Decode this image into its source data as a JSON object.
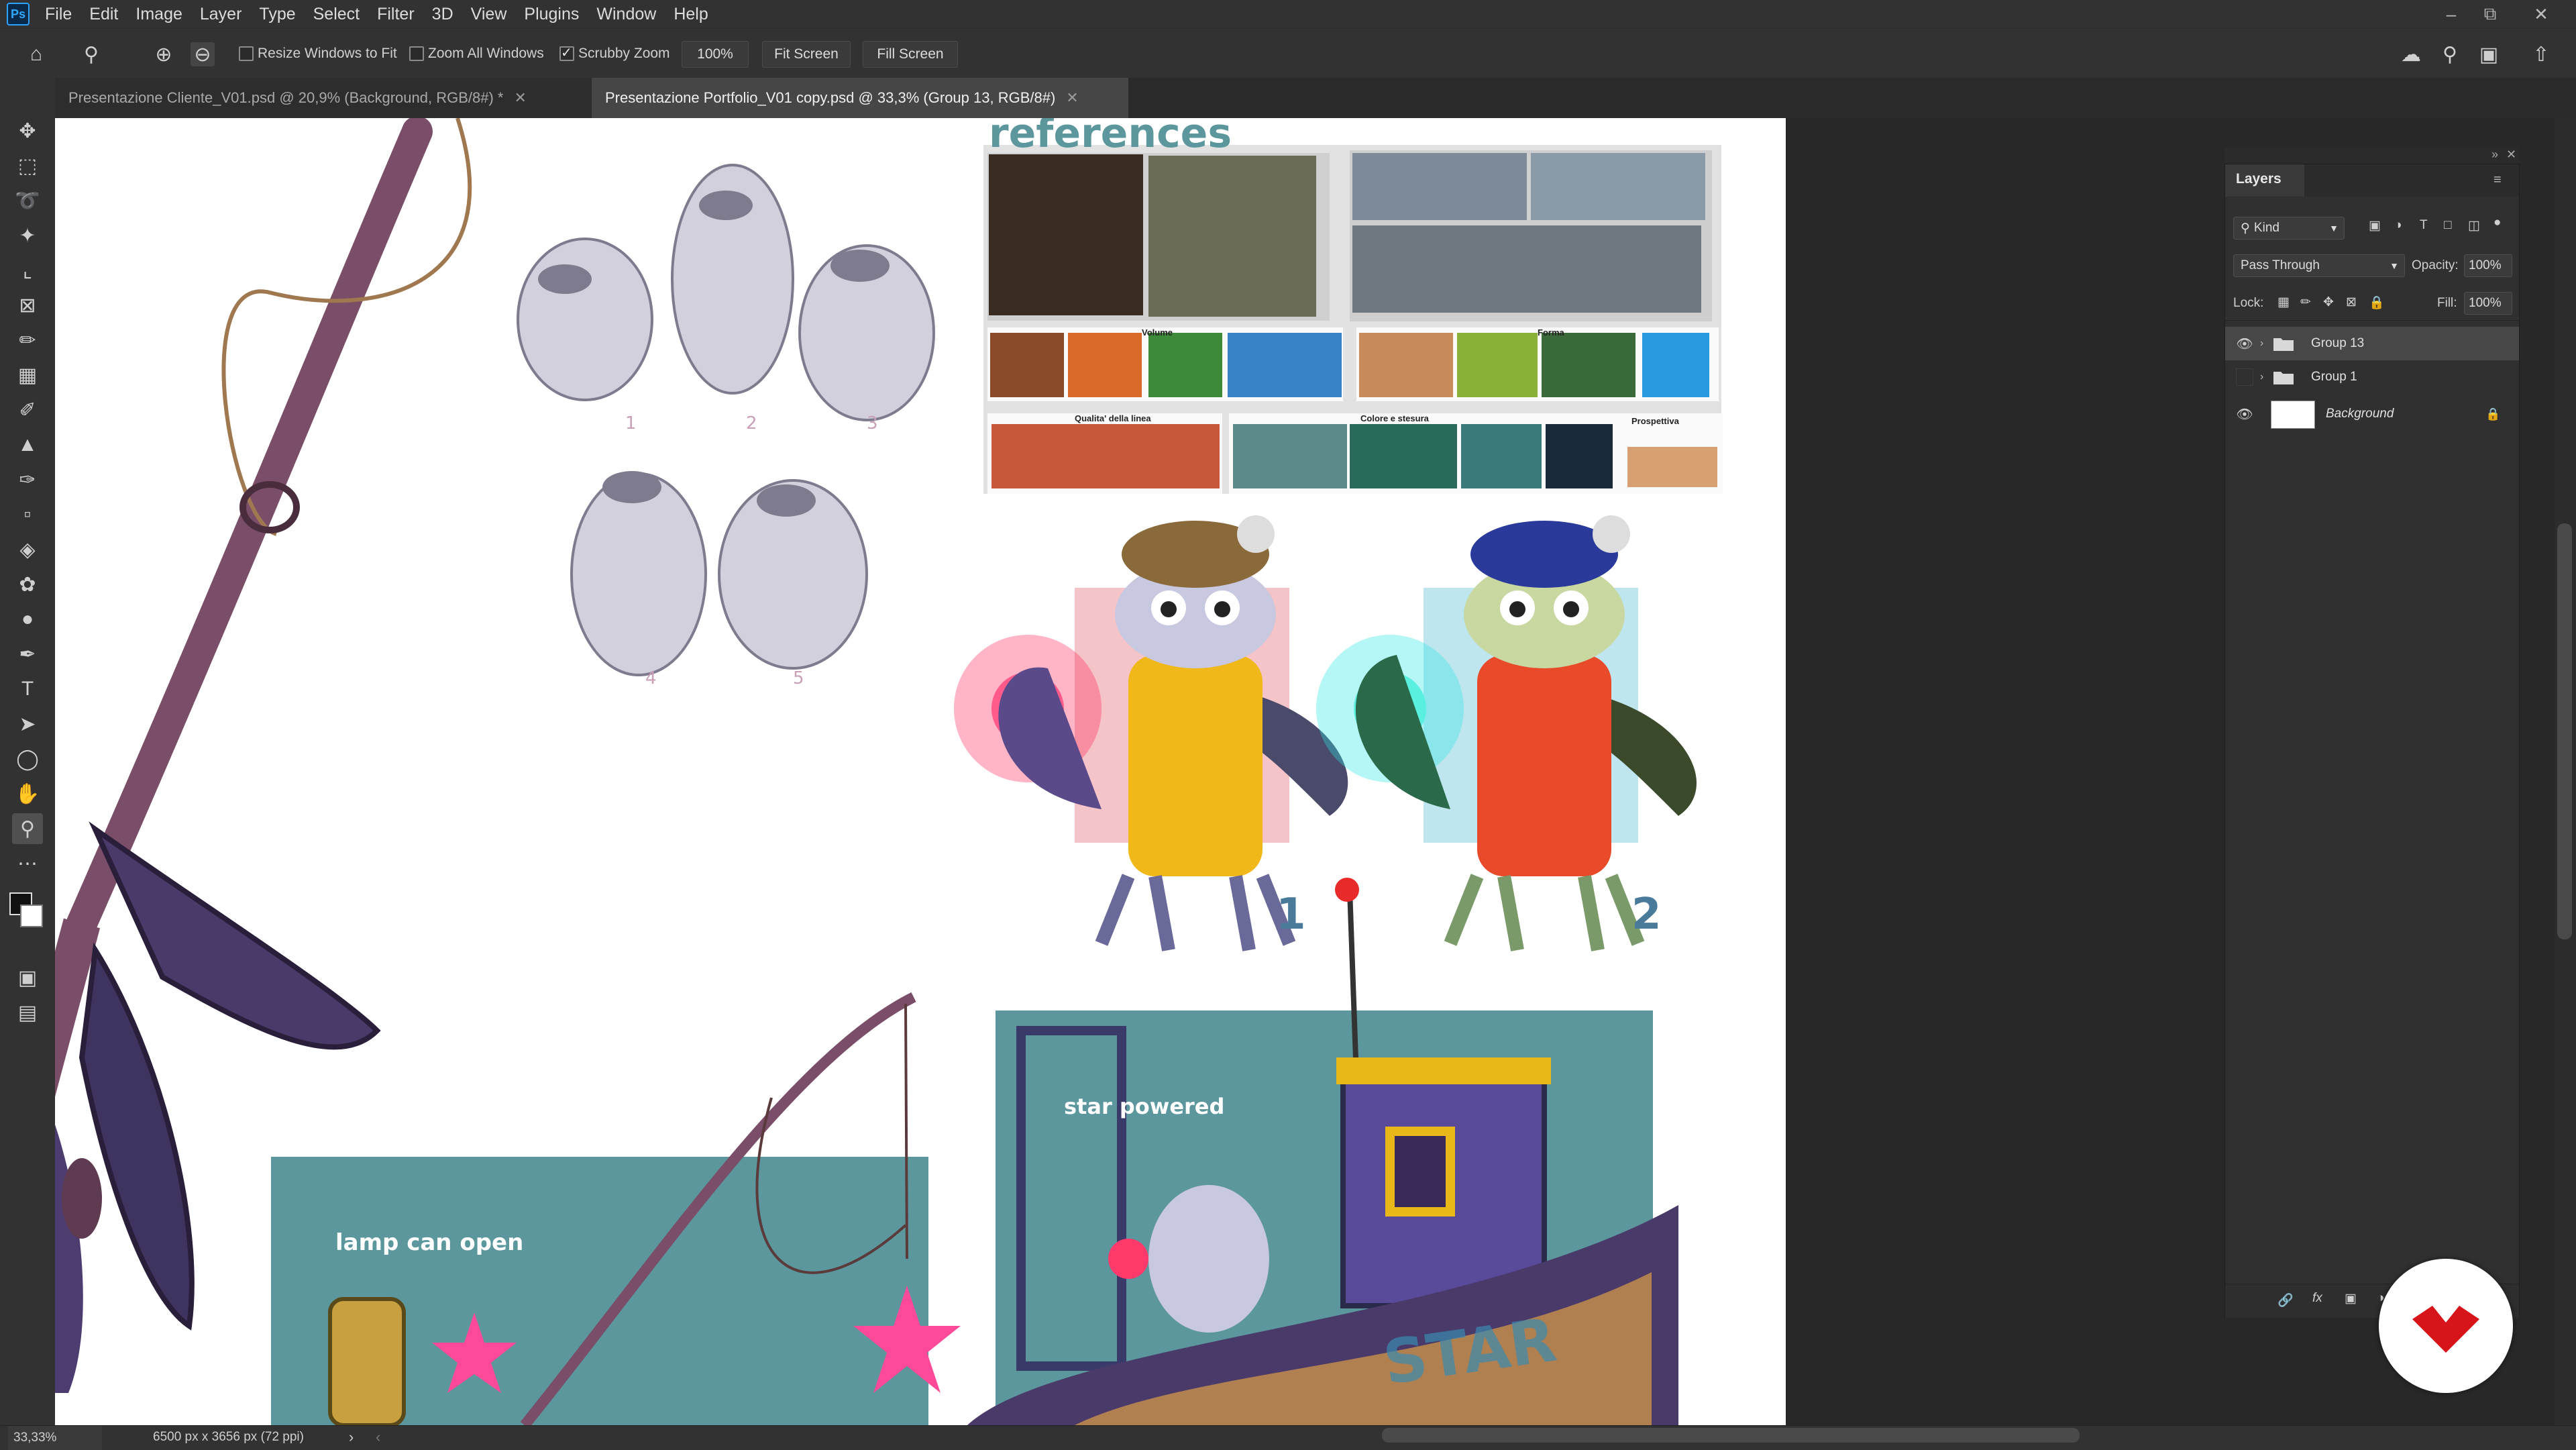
{
  "app": {
    "logo": "Ps"
  },
  "menu": [
    "File",
    "Edit",
    "Image",
    "Layer",
    "Type",
    "Select",
    "Filter",
    "3D",
    "View",
    "Plugins",
    "Window",
    "Help"
  ],
  "options": {
    "resize_windows": "Resize Windows to Fit",
    "zoom_all_windows": "Zoom All Windows",
    "scrubby_zoom": "Scrubby Zoom",
    "zoom_value": "100%",
    "fit_screen": "Fit Screen",
    "fill_screen": "Fill Screen"
  },
  "tabs": [
    {
      "label": "Presentazione Cliente_V01.psd @ 20,9% (Background, RGB/8#) *",
      "active": false
    },
    {
      "label": "Presentazione Portfolio_V01 copy.psd @ 33,3% (Group 13, RGB/8#)",
      "active": true
    }
  ],
  "document": {
    "references_title": "references",
    "ref_labels": [
      "Volume",
      "Forma",
      "Qualita' della linea",
      "Colore e stesura",
      "Prospettiva"
    ],
    "sketch_numbers": [
      "1",
      "2",
      "3",
      "4",
      "5"
    ],
    "variant_numbers": [
      "1",
      "2"
    ],
    "card_lamp": "lamp can open",
    "card_star": "star powered",
    "boat_text": "STAR"
  },
  "layers_panel": {
    "title": "Layers",
    "kind": "Kind",
    "blend_mode": "Pass Through",
    "opacity_label": "Opacity:",
    "opacity_value": "100%",
    "lock_label": "Lock:",
    "fill_label": "Fill:",
    "fill_value": "100%",
    "layers": [
      {
        "name": "Group 13",
        "visible": true,
        "selected": true
      },
      {
        "name": "Group 1",
        "visible": false,
        "selected": false
      },
      {
        "name": "Background",
        "visible": true,
        "selected": false
      }
    ]
  },
  "status": {
    "zoom": "33,33%",
    "doc_size": "6500 px x 3656 px (72 ppi)"
  },
  "colors": {
    "brand_badge": "#d7141a",
    "accent": "#2da3ff"
  }
}
